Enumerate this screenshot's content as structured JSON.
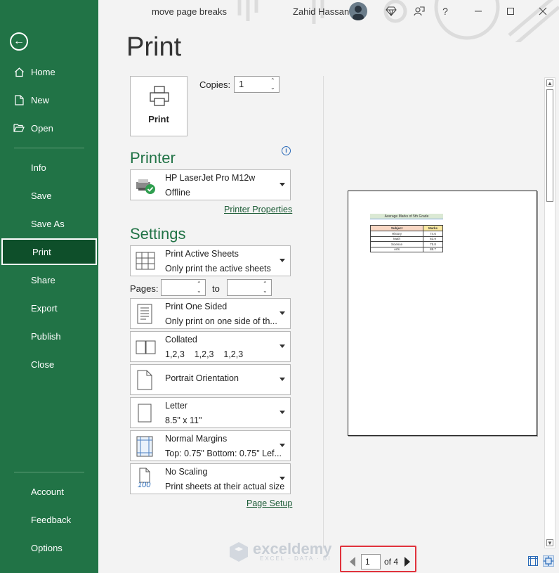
{
  "app": {
    "document_title": "move page breaks",
    "user_name": "Zahid Hassan"
  },
  "sidebar": {
    "items": [
      {
        "label": "Home",
        "icon": "home-icon"
      },
      {
        "label": "New",
        "icon": "new-file-icon"
      },
      {
        "label": "Open",
        "icon": "open-folder-icon"
      },
      {
        "label": "Info"
      },
      {
        "label": "Save"
      },
      {
        "label": "Save As"
      },
      {
        "label": "Print",
        "active": true
      },
      {
        "label": "Share"
      },
      {
        "label": "Export"
      },
      {
        "label": "Publish"
      },
      {
        "label": "Close"
      },
      {
        "label": "Account"
      },
      {
        "label": "Feedback"
      },
      {
        "label": "Options"
      }
    ]
  },
  "print": {
    "heading": "Print",
    "print_button_label": "Print",
    "copies_label": "Copies:",
    "copies_value": "1"
  },
  "printer": {
    "section_title": "Printer",
    "name": "HP LaserJet Pro M12w",
    "status": "Offline",
    "properties_link": "Printer Properties"
  },
  "settings": {
    "section_title": "Settings",
    "what_to_print": {
      "title": "Print Active Sheets",
      "subtitle": "Only print the active sheets"
    },
    "pages_label": "Pages:",
    "to_label": "to",
    "sides": {
      "title": "Print One Sided",
      "subtitle": "Only print on one side of th..."
    },
    "collation": {
      "title": "Collated",
      "subtitle": "1,2,3    1,2,3    1,2,3"
    },
    "orientation": {
      "title": "Portrait Orientation"
    },
    "paper": {
      "title": "Letter",
      "subtitle": "8.5\" x 11\""
    },
    "margins": {
      "title": "Normal Margins",
      "subtitle": "Top: 0.75\" Bottom: 0.75\" Lef..."
    },
    "scaling": {
      "title": "No Scaling",
      "subtitle": "Print sheets at their actual size",
      "icon_text": "100"
    },
    "page_setup_link": "Page Setup"
  },
  "preview": {
    "sheet_title": "Average Marks of 5th Grade",
    "table_headers": [
      "Subject",
      "Marks"
    ],
    "table_rows": [
      [
        "History",
        "74.6"
      ],
      [
        "Math",
        "83.9"
      ],
      [
        "Science",
        "75.8"
      ],
      [
        "Arts",
        "88.7"
      ]
    ]
  },
  "page_nav": {
    "current_page": "1",
    "of_text": "of 4"
  },
  "watermark": {
    "brand": "exceldemy",
    "tagline": "EXCEL · DATA · BI"
  },
  "colors": {
    "accent": "#217346",
    "active_item": "#0e4f2a",
    "highlight_border": "#e0323c"
  }
}
